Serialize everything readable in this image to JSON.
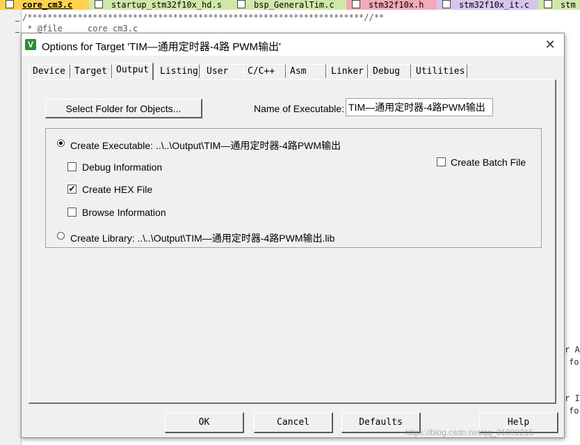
{
  "editor": {
    "file_tabs": [
      {
        "name": "core_cm3.c",
        "active": true
      },
      {
        "name": "startup_stm32f10x_hd.s",
        "active": false
      },
      {
        "name": "bsp_GeneralTim.c",
        "active": false
      },
      {
        "name": "stm32f10x.h",
        "active": false
      },
      {
        "name": "stm32f10x_it.c",
        "active": false
      },
      {
        "name": "stm",
        "active": false
      }
    ],
    "code_line_1": "/*******************************************************************//**",
    "code_line_2": " * @file     core_cm3.c",
    "code_right_1": "r A",
    "code_right_2": "fo",
    "code_right_3": "r I",
    "code_right_4": "fo",
    "watermark": "https://blog.csdn.net/qq_31092215"
  },
  "dialog": {
    "title": "Options for Target 'TIM—通用定时器-4路 PWM输出'",
    "tabs": [
      "Device",
      "Target",
      "Output",
      "Listing",
      "User",
      "C/C++",
      "Asm",
      "Linker",
      "Debug",
      "Utilities"
    ],
    "active_tab": "Output",
    "select_folder_label": "Select Folder for Objects...",
    "name_of_executable_label": "Name of Executable:",
    "name_of_executable_value": "TIM—通用定时器-4路PWM输出",
    "create_executable_label": "Create Executable:  ..\\..\\Output\\TIM—通用定时器-4路PWM输出",
    "debug_information_label": "Debug Information",
    "debug_information_checked": false,
    "create_hex_label": "Create HEX File",
    "create_hex_checked": true,
    "browse_information_label": "Browse Information",
    "browse_information_checked": false,
    "create_batch_label": "Create Batch File",
    "create_batch_checked": false,
    "create_library_label": "Create Library:  ..\\..\\Output\\TIM—通用定时器-4路PWM输出.lib",
    "selected_output": "executable",
    "buttons": {
      "ok": "OK",
      "cancel": "Cancel",
      "defaults": "Defaults",
      "help": "Help"
    }
  }
}
